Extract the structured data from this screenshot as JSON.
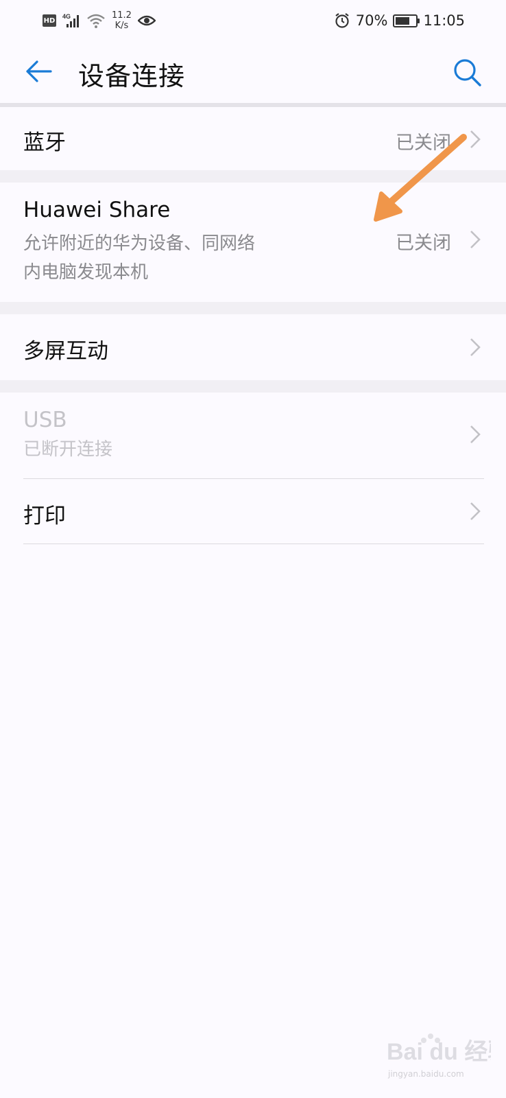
{
  "status_bar": {
    "hd": "HD",
    "network": "4G",
    "speed_value": "11.2",
    "speed_unit": "K/s",
    "battery_percent": "70%",
    "battery_level": 0.7,
    "time": "11:05"
  },
  "header": {
    "title": "设备连接",
    "back_icon": "back-arrow-icon",
    "search_icon": "search-icon"
  },
  "items": [
    {
      "title": "蓝牙",
      "value": "已关闭"
    },
    {
      "title": "Huawei Share",
      "subtitle_line1": "允许附近的华为设备、同网络",
      "subtitle_line2": "内电脑发现本机",
      "value": "已关闭"
    },
    {
      "title": "多屏互动"
    },
    {
      "title": "USB",
      "subtitle": "已断开连接",
      "disabled": true
    },
    {
      "title": "打印"
    }
  ],
  "watermark": {
    "text": "Bai du 经验",
    "url_text": "jingyan.baidu.com"
  },
  "colors": {
    "accent": "#1a7bd6",
    "annotation_arrow": "#f0964a",
    "background": "#fcfaff"
  }
}
